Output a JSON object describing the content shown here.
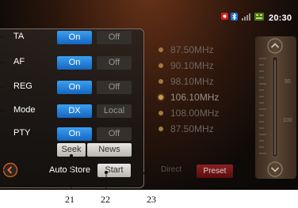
{
  "status": {
    "clock": "20:30"
  },
  "settings": [
    {
      "label": "TA",
      "on": "On",
      "off": "Off"
    },
    {
      "label": "AF",
      "on": "On",
      "off": "Off"
    },
    {
      "label": "REG",
      "on": "On",
      "off": "Off"
    },
    {
      "label": "Mode",
      "on": "DX",
      "off": "Local"
    },
    {
      "label": "PTY",
      "on": "On",
      "off": "Off"
    }
  ],
  "buttons": {
    "seek": "Seek",
    "news": "News",
    "auto_store_label": "Auto Store",
    "start": "Start"
  },
  "stations": [
    "87.50MHz",
    "90.10MHz",
    "98.10MHz",
    "106.10MHz",
    "108.00MHz",
    "87.50MHz"
  ],
  "active_station_index": 3,
  "tabs": {
    "direct": "Direct",
    "preset": "Preset"
  },
  "dial_labels": [
    "95",
    "100"
  ],
  "callouts": [
    "21",
    "22",
    "23"
  ]
}
